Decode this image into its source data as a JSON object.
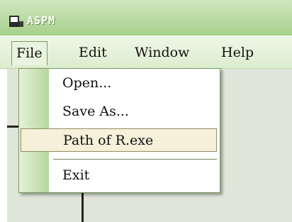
{
  "app": {
    "title": "ASPM"
  },
  "menubar": {
    "items": [
      "File",
      "Edit",
      "Window",
      "Help"
    ]
  },
  "file_menu": {
    "items": [
      "Open...",
      "Save As...",
      "Path of R.exe",
      "Exit"
    ]
  },
  "colors": {
    "titlebar": "#a8d08d",
    "menubar": "#dcedcf",
    "highlight": "#f6f0da"
  },
  "icons": {
    "app": "app-window-icon"
  }
}
